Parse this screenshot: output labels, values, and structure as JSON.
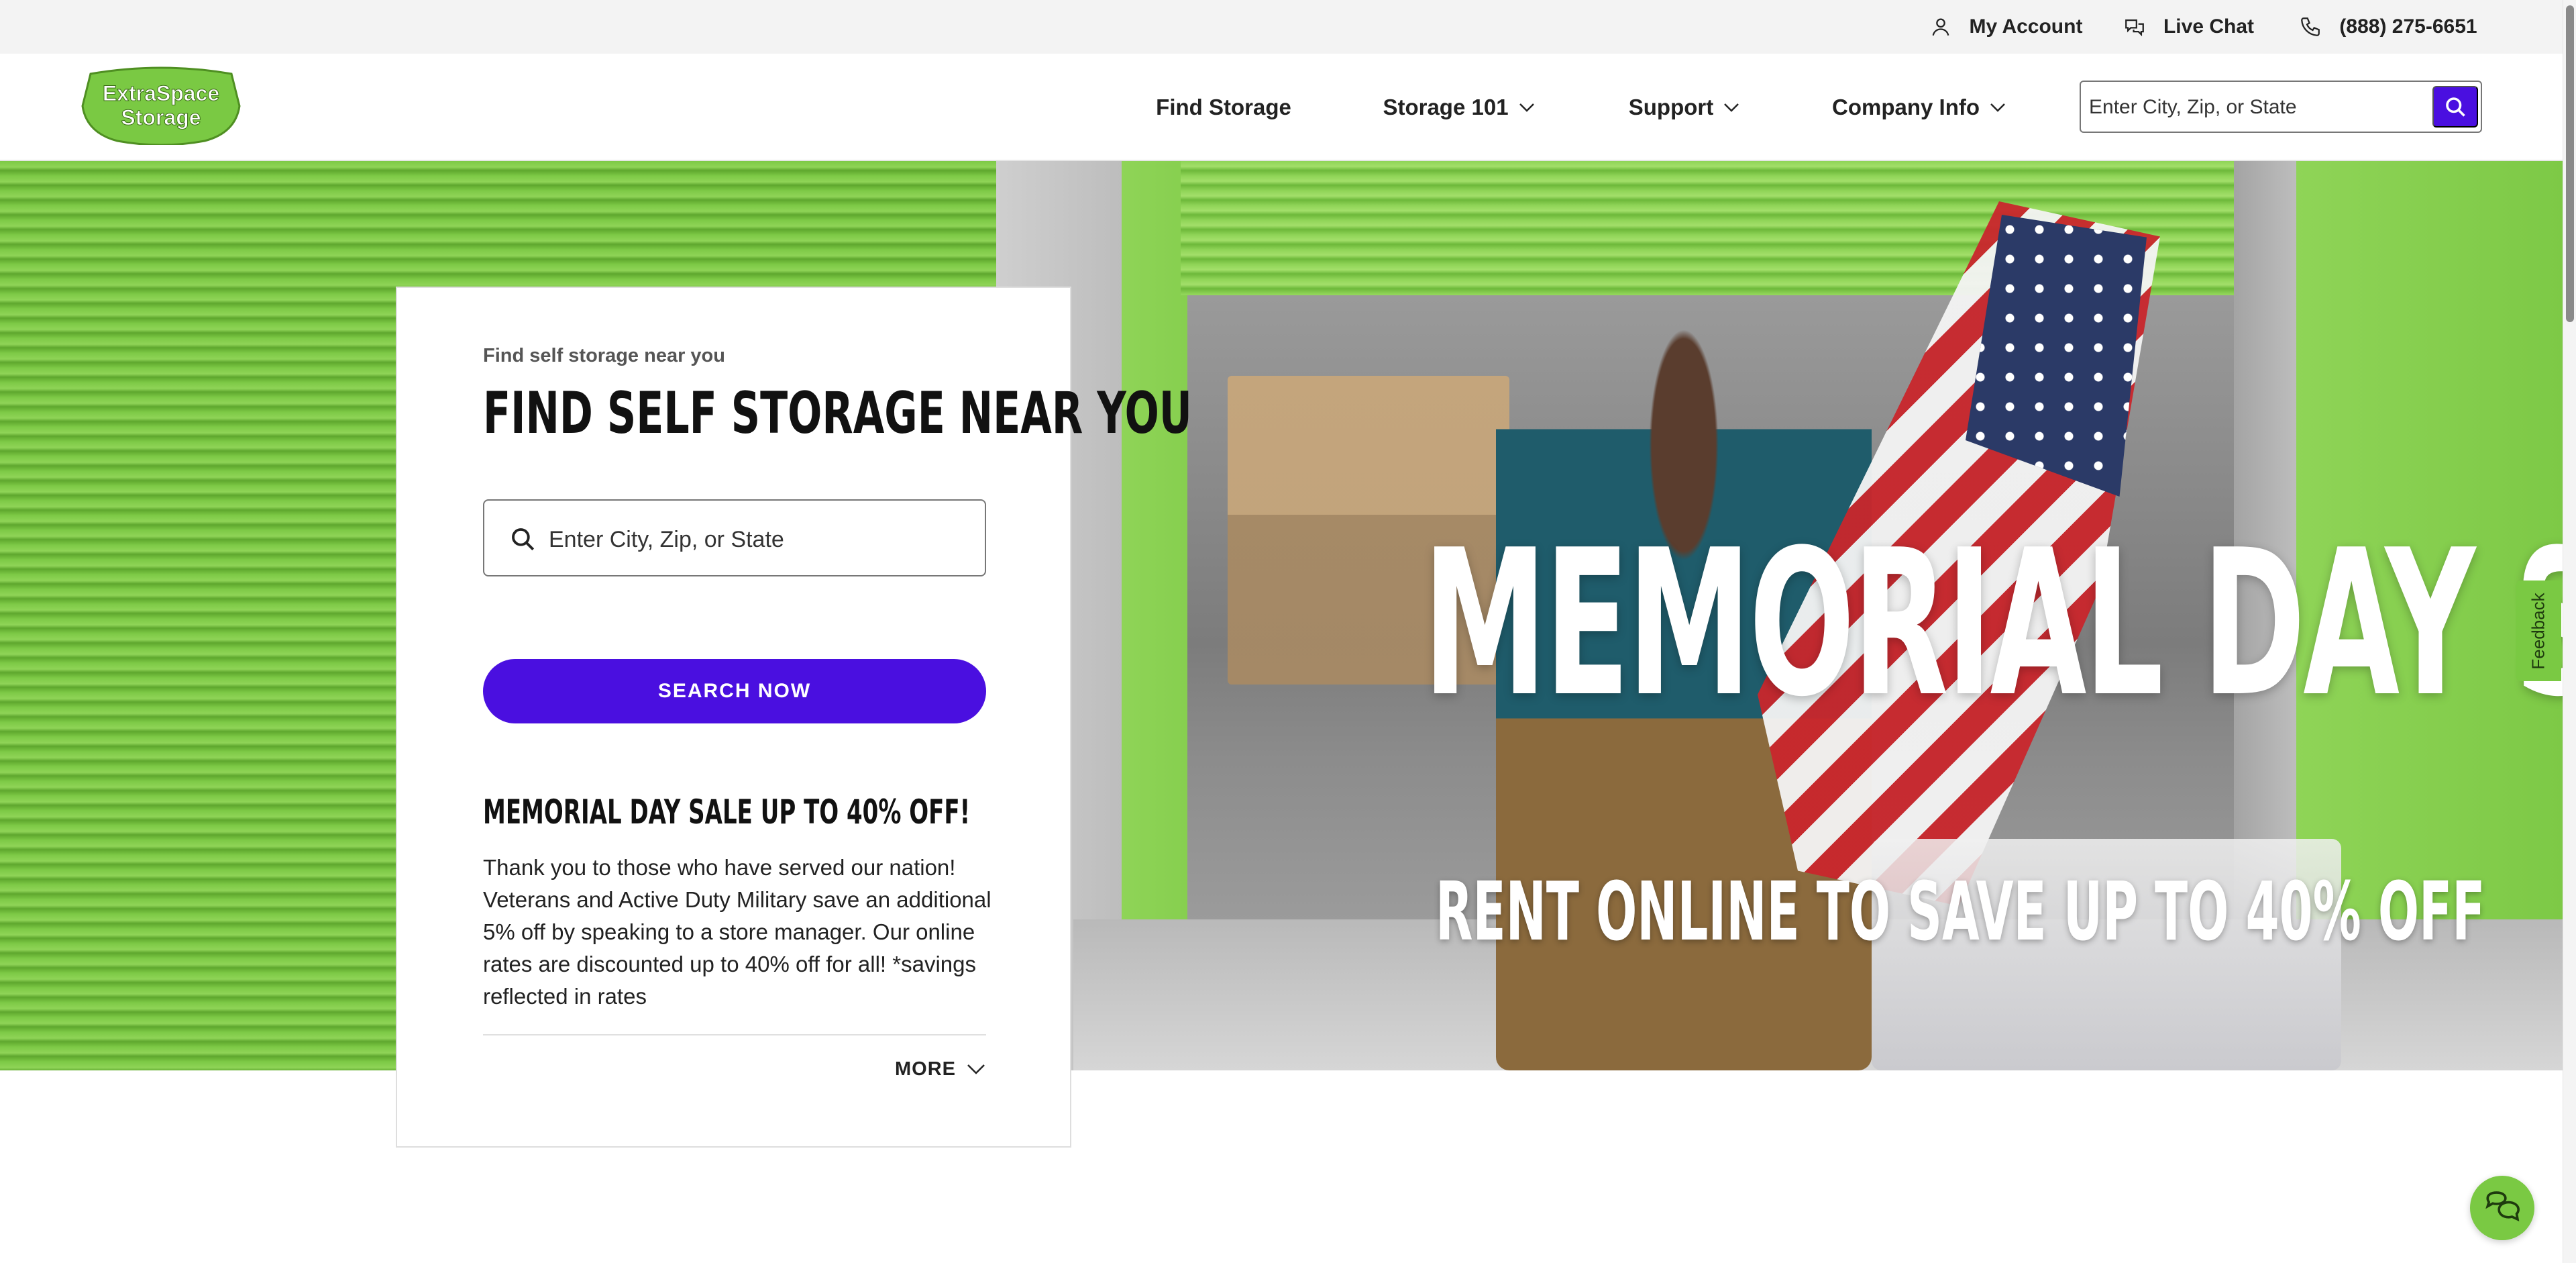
{
  "utility_bar": {
    "account_label": "My Account",
    "chat_label": "Live Chat",
    "phone_label": "(888) 275-6651"
  },
  "header": {
    "logo_text_line1": "ExtraSpace",
    "logo_text_line2": "Storage",
    "nav": {
      "find_storage": "Find Storage",
      "storage_101": "Storage 101",
      "support": "Support",
      "company_info": "Company Info"
    },
    "search_placeholder": "Enter City, Zip, or State"
  },
  "hero": {
    "headline": "MEMORIAL DAY SALE",
    "subhead": "RENT ONLINE TO SAVE UP TO 40% OFF"
  },
  "card": {
    "eyebrow": "Find self storage near you",
    "title": "FIND SELF STORAGE NEAR YOU",
    "search_placeholder": "Enter City, Zip, or State",
    "button_label": "SEARCH NOW",
    "sale_title": "MEMORIAL DAY SALE UP TO 40% OFF!",
    "body": "Thank you to those who have served our nation! Veterans and Active Duty Military save an additional 5% off by speaking to a store manager. Our online rates are discounted up to 40% off for all! *savings reflected in rates",
    "more_label": "MORE"
  },
  "feedback_label": "Feedback",
  "colors": {
    "brand_green": "#7ac943",
    "accent_purple": "#4a0fe0"
  }
}
